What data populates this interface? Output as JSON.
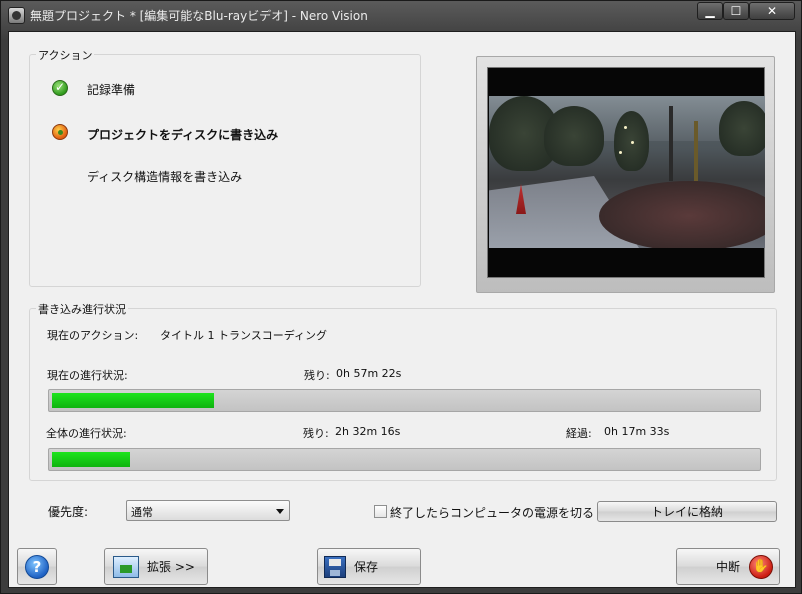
{
  "window": {
    "title": "無題プロジェクト * [編集可能なBlu-rayビデオ] - Nero Vision",
    "minimize_glyph": "▁",
    "maximize_glyph": "☐",
    "close_glyph": "✕"
  },
  "actions_group": {
    "title": "アクション",
    "items": [
      {
        "label": "記録準備",
        "status": "done",
        "icon": "check-icon"
      },
      {
        "label": "プロジェクトをディスクに書き込み",
        "status": "in-progress",
        "icon": "busy-icon"
      },
      {
        "label": "ディスク構造情報を書き込み",
        "status": "pending",
        "icon": ""
      }
    ]
  },
  "progress_group": {
    "title": "書き込み進行状況",
    "current_action_label": "現在のアクション:",
    "current_action_value": "タイトル 1 トランスコーディング",
    "current_progress_label": "現在の進行状況:",
    "current_remaining_label": "残り:",
    "current_remaining_value": "0h 57m 22s",
    "current_progress_fraction": 0.23,
    "overall_progress_label": "全体の進行状況:",
    "overall_remaining_label": "残り:",
    "overall_remaining_value": "2h 32m 16s",
    "overall_elapsed_label": "経過:",
    "overall_elapsed_value": "0h 17m 33s",
    "overall_progress_fraction": 0.11
  },
  "options": {
    "priority_label": "優先度:",
    "priority_value": "通常",
    "shutdown_checkbox_label": "終了したらコンピュータの電源を切る",
    "shutdown_checked": false,
    "tray_button_label": "トレイに格納"
  },
  "footer": {
    "help_glyph": "?",
    "expand_label": "拡張 >>",
    "save_label": "保存",
    "abort_label": "中断",
    "stop_glyph": "✋"
  },
  "colors": {
    "progress_fill": "#14cf14",
    "window_frame": "#444444"
  }
}
